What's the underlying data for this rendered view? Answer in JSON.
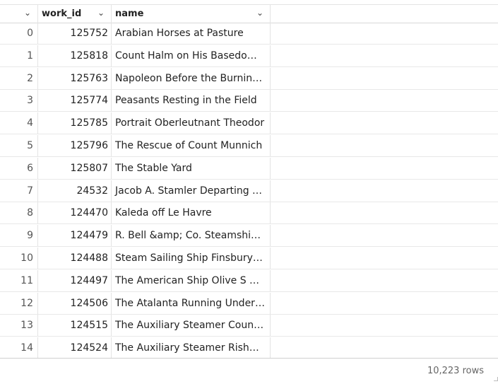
{
  "table": {
    "columns": [
      {
        "label": "",
        "icon": "chevron-down-icon"
      },
      {
        "label": "work_id",
        "icon": "chevron-down-icon"
      },
      {
        "label": "name",
        "icon": "chevron-down-icon"
      }
    ],
    "rows": [
      {
        "index": "0",
        "work_id": "125752",
        "name": "Arabian Horses at Pasture"
      },
      {
        "index": "1",
        "work_id": "125818",
        "name": "Count Halm on His Basedow Horse"
      },
      {
        "index": "2",
        "work_id": "125763",
        "name": "Napoleon Before the Burning of Moscow"
      },
      {
        "index": "3",
        "work_id": "125774",
        "name": "Peasants Resting in the Field"
      },
      {
        "index": "4",
        "work_id": "125785",
        "name": "Portrait Oberleutnant Theodor"
      },
      {
        "index": "5",
        "work_id": "125796",
        "name": "The Rescue of Count Munnich"
      },
      {
        "index": "6",
        "work_id": "125807",
        "name": "The Stable Yard"
      },
      {
        "index": "7",
        "work_id": "24532",
        "name": "Jacob A. Stamler Departing Le Havre"
      },
      {
        "index": "8",
        "work_id": "124470",
        "name": "Kaleda off Le Havre"
      },
      {
        "index": "9",
        "work_id": "124479",
        "name": "R. Bell &amp; Co. Steamship Company"
      },
      {
        "index": "10",
        "work_id": "124488",
        "name": "Steam Sailing Ship Finsbury in"
      },
      {
        "index": "11",
        "work_id": "124497",
        "name": "The American Ship Olive S Southard"
      },
      {
        "index": "12",
        "work_id": "124506",
        "name": "The Atalanta Running Under Sail"
      },
      {
        "index": "13",
        "work_id": "124515",
        "name": "The Auxiliary Steamer Countess"
      },
      {
        "index": "14",
        "work_id": "124524",
        "name": "The Auxiliary Steamer Rishangles"
      }
    ]
  },
  "footer": {
    "row_count": "10,223 rows"
  }
}
